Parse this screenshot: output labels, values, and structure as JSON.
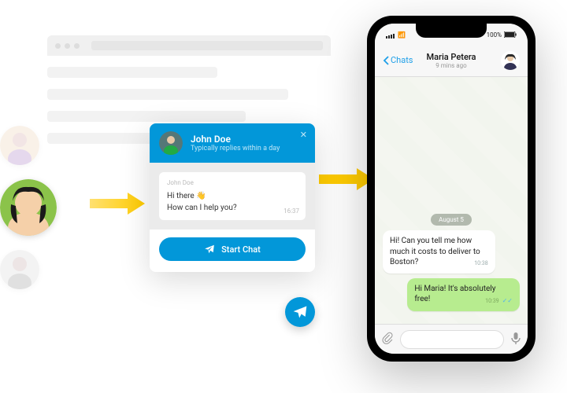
{
  "widget": {
    "agent_name": "John Doe",
    "subtitle": "Typically replies within a day",
    "bubble_from": "John Doe",
    "bubble_line1": "Hi there 👋",
    "bubble_line2": "How can I help you?",
    "bubble_time": "16:37",
    "start_label": "Start Chat"
  },
  "phone": {
    "status_battery": "100%",
    "back_label": "Chats",
    "contact_name": "Maria Petera",
    "contact_sub": "9 mins ago",
    "date_pill": "August 5",
    "msg_in": "Hi! Can you tell me how much it costs to deliver to Boston?",
    "msg_in_time": "10:38",
    "msg_out": "Hi Maria! It's absolutely free!",
    "msg_out_time": "10:39"
  }
}
